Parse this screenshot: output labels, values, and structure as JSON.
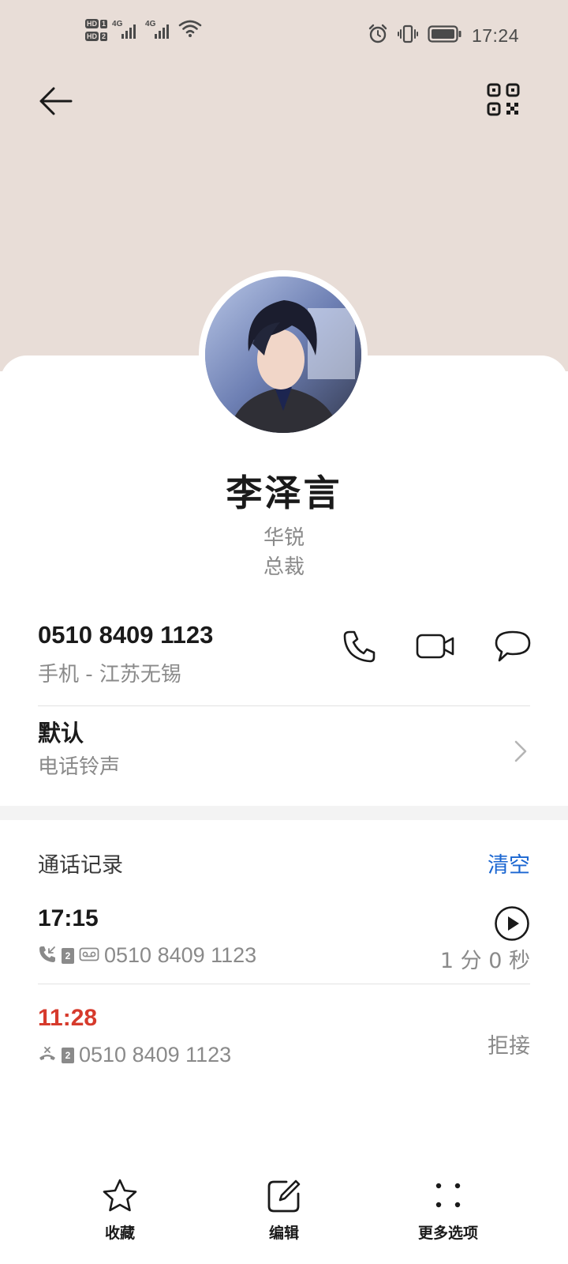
{
  "status_bar": {
    "sim1": {
      "hd": "HD",
      "slot": "1",
      "network": "4G"
    },
    "sim2": {
      "hd": "HD",
      "slot": "2",
      "network": "4G"
    },
    "time": "17:24",
    "icons": [
      "wifi-icon",
      "alarm-icon",
      "vibrate-icon",
      "battery-icon"
    ]
  },
  "header": {
    "back_icon": "back-arrow-icon",
    "qr_icon": "qr-code-icon",
    "background_color": "#e8ddd7"
  },
  "contact": {
    "name": "李泽言",
    "company": "华锐",
    "title": "总裁"
  },
  "phone": {
    "number": "0510 8409 1123",
    "label": "手机 - 江苏无锡",
    "actions": [
      "phone-icon",
      "video-call-icon",
      "message-icon"
    ]
  },
  "ringtone": {
    "value": "默认",
    "label": "电话铃声"
  },
  "call_history": {
    "title": "通话记录",
    "clear_label": "清空",
    "accent_color": "#1a66d1",
    "items": [
      {
        "time": "17:15",
        "number": "0510 8409 1123",
        "sim": "2",
        "duration": "1 分 0 秒",
        "type": "incoming-recorded"
      },
      {
        "time": "11:28",
        "number": "0510 8409 1123",
        "sim": "2",
        "status": "拒接",
        "type": "rejected",
        "color": "#d63a2c"
      }
    ]
  },
  "bottom_bar": {
    "favorite_label": "收藏",
    "edit_label": "编辑",
    "more_label": "更多选项"
  }
}
